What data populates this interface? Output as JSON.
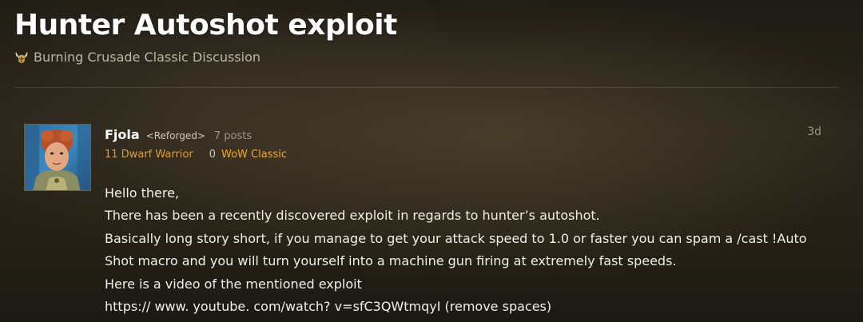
{
  "topic": {
    "title": "Hunter Autoshot exploit",
    "category": "Burning Crusade Classic Discussion",
    "category_icon": "horned-helmet-icon"
  },
  "post": {
    "author": {
      "name": "Fjola",
      "guild": "<Reforged>",
      "post_count": "7 posts",
      "character": "11 Dwarf Warrior",
      "achievement_points": "0",
      "realm": "WoW Classic",
      "avatar": "character-avatar"
    },
    "date": "3d",
    "body": [
      "Hello there,",
      "There has been a recently discovered exploit in regards to hunter’s autoshot.",
      "Basically long story short, if you manage to get your attack speed to 1.0 or faster you can spam a /cast !Auto",
      "Shot macro and you will turn yourself into a machine gun firing at extremely fast speeds.",
      "Here is a video of the mentioned exploit",
      "https:// www. youtube. com/watch? v=sfC3QWtmqyI (remove spaces)"
    ]
  },
  "colors": {
    "character_class": "#e29a3d",
    "realm": "#f5a623",
    "muted_text": "#9e978a"
  }
}
